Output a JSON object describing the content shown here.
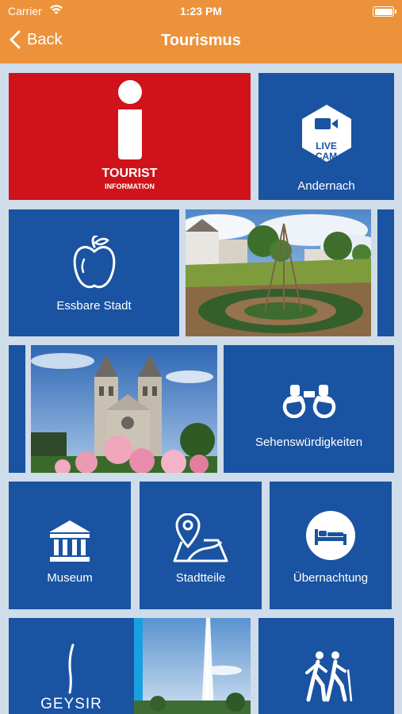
{
  "status_bar": {
    "carrier": "Carrier",
    "time": "1:23 PM"
  },
  "nav": {
    "back_label": "Back",
    "title": "Tourismus"
  },
  "tiles": {
    "tourist_info": {
      "line1": "TOURIST",
      "line2": "INFORMATION"
    },
    "live_cam": {
      "badge_line1": "LIVE",
      "badge_line2": "CAM",
      "label": "Andernach"
    },
    "essbare_stadt": {
      "label": "Essbare Stadt"
    },
    "sehenswuerdigkeiten": {
      "label": "Sehenswürdigkeiten"
    },
    "museum": {
      "label": "Museum"
    },
    "stadtteile": {
      "label": "Stadtteile"
    },
    "uebernachtung": {
      "label": "Übernachtung"
    },
    "geysir": {
      "logo_text": "GEYSIR"
    }
  },
  "colors": {
    "header": "#ec923b",
    "tile_blue": "#1a53a1",
    "tile_red": "#d0121b",
    "background": "#cfdce9"
  }
}
